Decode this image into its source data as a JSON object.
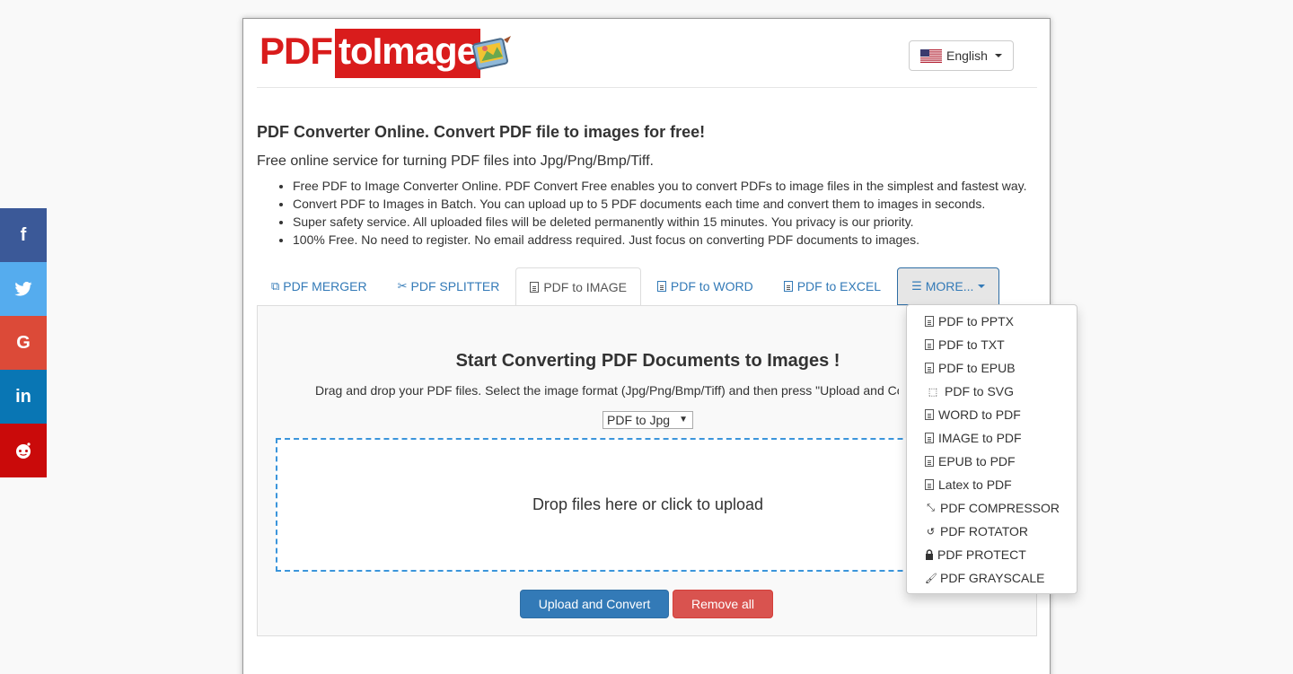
{
  "social": [
    {
      "name": "facebook",
      "glyph": "f"
    },
    {
      "name": "twitter",
      "glyph": "t"
    },
    {
      "name": "google",
      "glyph": "G"
    },
    {
      "name": "linkedin",
      "glyph": "in"
    },
    {
      "name": "reddit",
      "glyph": "●"
    }
  ],
  "logo": {
    "part1": "PDF",
    "part2": "toImage"
  },
  "language": {
    "label": "English"
  },
  "intro": {
    "title": "PDF Converter Online. Convert PDF file to images for free!",
    "subtitle": "Free online service for turning PDF files into Jpg/Png/Bmp/Tiff.",
    "bullets": [
      "Free PDF to Image Converter Online. PDF Convert Free enables you to convert PDFs to image files in the simplest and fastest way.",
      "Convert PDF to Images in Batch. You can upload up to 5 PDF documents each time and convert them to images in seconds.",
      "Super safety service. All uploaded files will be deleted permanently within 15 minutes. You privacy is our priority.",
      "100% Free. No need to register. No email address required. Just focus on converting PDF documents to images."
    ]
  },
  "tabs": [
    {
      "label": "PDF MERGER",
      "icon": "copy-icon"
    },
    {
      "label": "PDF SPLITTER",
      "icon": "scissors-icon"
    },
    {
      "label": "PDF to IMAGE",
      "icon": "image-file-icon"
    },
    {
      "label": "PDF to WORD",
      "icon": "word-file-icon"
    },
    {
      "label": "PDF to EXCEL",
      "icon": "excel-file-icon"
    },
    {
      "label": "MORE...",
      "icon": "list-icon"
    }
  ],
  "main": {
    "heading": "Start Converting PDF Documents to Images !",
    "description": "Drag and drop your PDF files. Select the image format (Jpg/Png/Bmp/Tiff) and then press \"Upload and Convert\".",
    "format_select": "PDF to Jpg",
    "dropzone": "Drop files here or click to upload",
    "upload_button": "Upload and Convert",
    "remove_button": "Remove all"
  },
  "more_menu": [
    {
      "label": "PDF to PPTX",
      "icon": "ppt-file-icon"
    },
    {
      "label": "PDF to TXT",
      "icon": "text-file-icon"
    },
    {
      "label": "PDF to EPUB",
      "icon": "epub-file-icon"
    },
    {
      "label": "PDF to SVG",
      "icon": "vector-icon"
    },
    {
      "label": "WORD to PDF",
      "icon": "pdf-file-icon"
    },
    {
      "label": "IMAGE to PDF",
      "icon": "pdf-file-icon"
    },
    {
      "label": "EPUB to PDF",
      "icon": "pdf-file-icon"
    },
    {
      "label": "Latex to PDF",
      "icon": "pdf-file-icon"
    },
    {
      "label": "PDF COMPRESSOR",
      "icon": "compress-icon"
    },
    {
      "label": "PDF ROTATOR",
      "icon": "rotate-icon"
    },
    {
      "label": "PDF PROTECT",
      "icon": "lock-icon"
    },
    {
      "label": "PDF GRAYSCALE",
      "icon": "brush-icon"
    }
  ],
  "colors": {
    "brand_red": "#d91c1c",
    "link_blue": "#337ab7",
    "primary_button": "#337ab7",
    "danger_button": "#d9534f",
    "dropzone_border": "#3b95db"
  }
}
